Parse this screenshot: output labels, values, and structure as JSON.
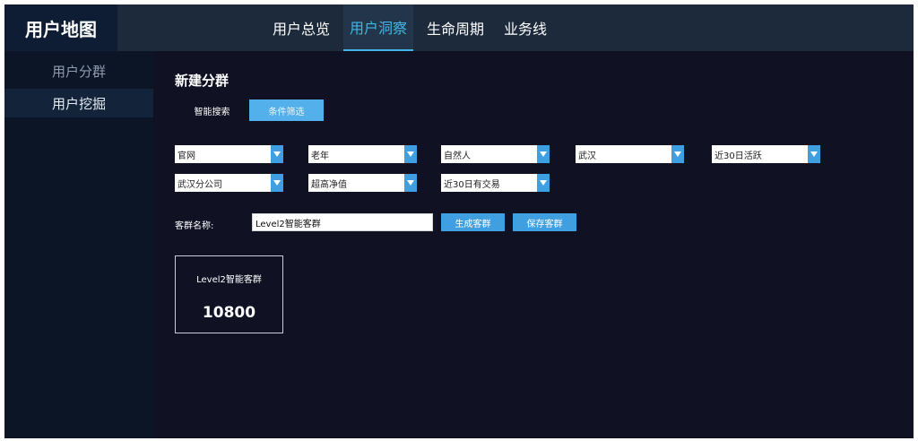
{
  "app": {
    "title": "用户地图"
  },
  "top_nav": {
    "tabs": [
      {
        "label": "用户总览",
        "active": false
      },
      {
        "label": "用户洞察",
        "active": true
      },
      {
        "label": "生命周期",
        "active": false
      },
      {
        "label": "业务线",
        "active": false
      }
    ]
  },
  "sidebar": {
    "items": [
      {
        "label": "用户分群",
        "active": false
      },
      {
        "label": "用户挖掘",
        "active": true
      }
    ]
  },
  "main": {
    "title": "新建分群",
    "mode_tabs": [
      {
        "label": "智能搜索",
        "active": false
      },
      {
        "label": "条件筛选",
        "active": true
      }
    ],
    "filters": [
      {
        "value": "官网",
        "icon": "chevron-down-icon"
      },
      {
        "value": "老年",
        "icon": "chevron-down-icon"
      },
      {
        "value": "自然人",
        "icon": "chevron-down-icon"
      },
      {
        "value": "武汉",
        "icon": "chevron-down-icon"
      },
      {
        "value": "近30日活跃",
        "icon": "chevron-down-icon"
      },
      {
        "value": "武汉分公司",
        "icon": "chevron-down-icon"
      },
      {
        "value": "超高净值",
        "icon": "chevron-down-icon"
      },
      {
        "value": "近30日有交易",
        "icon": "chevron-down-icon"
      }
    ],
    "group_name": {
      "label": "客群名称:",
      "value": "Level2智能客群"
    },
    "buttons": {
      "generate": "生成客群",
      "save": "保存客群"
    },
    "result_card": {
      "title": "Level2智能客群",
      "value": "10800"
    }
  },
  "colors": {
    "background": "#101224",
    "header": "#1c2a3b",
    "sidebar": "#0b1526",
    "accent": "#41b6e6",
    "button": "#3f9fe0"
  }
}
